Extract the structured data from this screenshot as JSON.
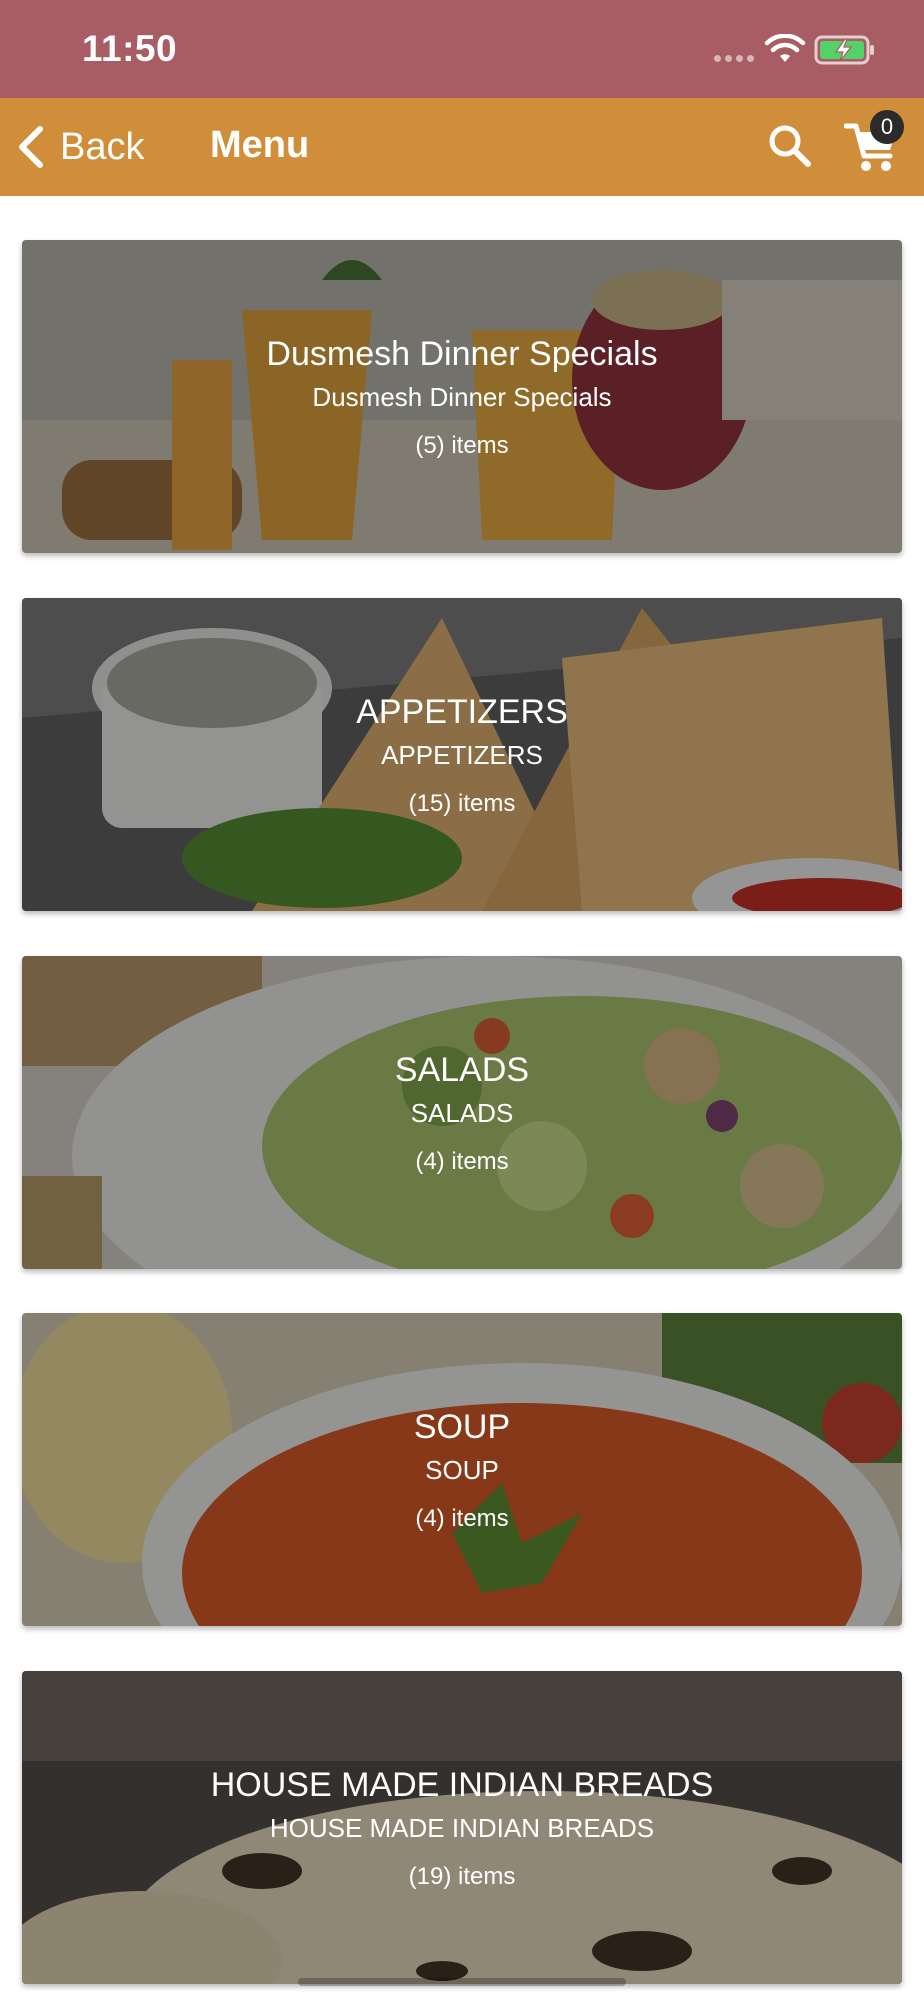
{
  "status_bar": {
    "time": "11:50",
    "icons": [
      "signal-dots-icon",
      "wifi-icon",
      "battery-charging-icon"
    ]
  },
  "nav": {
    "back_label": "Back",
    "title": "Menu",
    "cart_count": "0",
    "icons": [
      "chevron-left-icon",
      "search-icon",
      "cart-icon"
    ],
    "colors": {
      "status_bar": "#a85c63",
      "nav_bar": "#d08e3a"
    }
  },
  "categories": [
    {
      "title": "Dusmesh Dinner Specials",
      "subtitle": "Dusmesh Dinner Specials",
      "count": "(5) items",
      "image": "drinks-photo"
    },
    {
      "title": "APPETIZERS",
      "subtitle": "APPETIZERS",
      "count": "(15) items",
      "image": "samosa-photo"
    },
    {
      "title": "SALADS",
      "subtitle": "SALADS",
      "count": "(4) items",
      "image": "salad-photo"
    },
    {
      "title": "SOUP",
      "subtitle": "SOUP",
      "count": "(4) items",
      "image": "soup-photo"
    },
    {
      "title": "HOUSE MADE INDIAN BREADS",
      "subtitle": "HOUSE MADE INDIAN BREADS",
      "count": "(19) items",
      "image": "naan-photo"
    }
  ]
}
